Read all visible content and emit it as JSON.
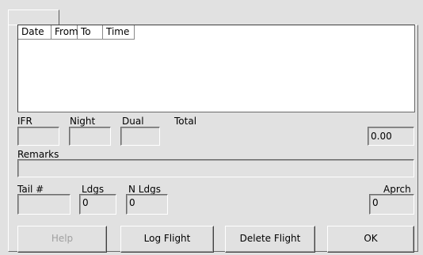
{
  "list": {
    "columns": [
      "Date",
      "From",
      "To",
      "Time"
    ]
  },
  "labels": {
    "ifr": "IFR",
    "night": "Night",
    "dual": "Dual",
    "total": "Total",
    "remarks": "Remarks",
    "tail": "Tail #",
    "ldgs": "Ldgs",
    "n_ldgs": "N Ldgs",
    "aprch": "Aprch"
  },
  "fields": {
    "ifr": "",
    "night": "",
    "dual": "",
    "total": "0.00",
    "remarks": "",
    "tail": "",
    "ldgs": "0",
    "n_ldgs": "0",
    "aprch": "0"
  },
  "buttons": {
    "help": "Help",
    "log_flight": "Log Flight",
    "delete_flight": "Delete Flight",
    "ok": "OK"
  }
}
